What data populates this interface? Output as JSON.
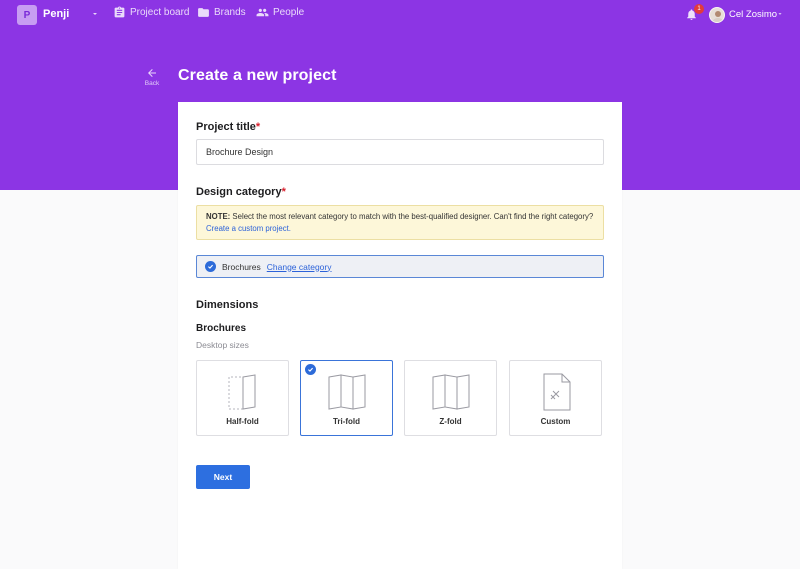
{
  "header": {
    "logo_letter": "P",
    "brand": "Penji",
    "nav": [
      {
        "label": "Project board",
        "icon": "clipboard-icon"
      },
      {
        "label": "Brands",
        "icon": "folder-icon"
      },
      {
        "label": "People",
        "icon": "people-icon"
      }
    ],
    "notification_count": "1",
    "user_name": "Cel Zosimo"
  },
  "page": {
    "back_label": "Back",
    "title": "Create a new project"
  },
  "form": {
    "project_title": {
      "label": "Project title",
      "required_mark": "*",
      "value": "Brochure Design"
    },
    "design_category": {
      "label": "Design category",
      "required_mark": "*",
      "note_prefix": "NOTE:",
      "note_text": " Select the most relevant category to match with the best-qualified designer. Can't find the right category? ",
      "note_link": "Create a custom project.",
      "selected": "Brochures",
      "change_link": "Change category"
    },
    "dimensions": {
      "label": "Dimensions",
      "sub_label": "Brochures",
      "hint": "Desktop sizes",
      "options": [
        {
          "label": "Half-fold",
          "selected": false
        },
        {
          "label": "Tri-fold",
          "selected": true
        },
        {
          "label": "Z-fold",
          "selected": false
        },
        {
          "label": "Custom",
          "selected": false
        }
      ]
    },
    "next_label": "Next"
  },
  "colors": {
    "header_purple": "#8c35e4",
    "primary_blue": "#2d6fe0",
    "required_red": "#d81f2c",
    "note_bg": "#fdf7d9"
  }
}
